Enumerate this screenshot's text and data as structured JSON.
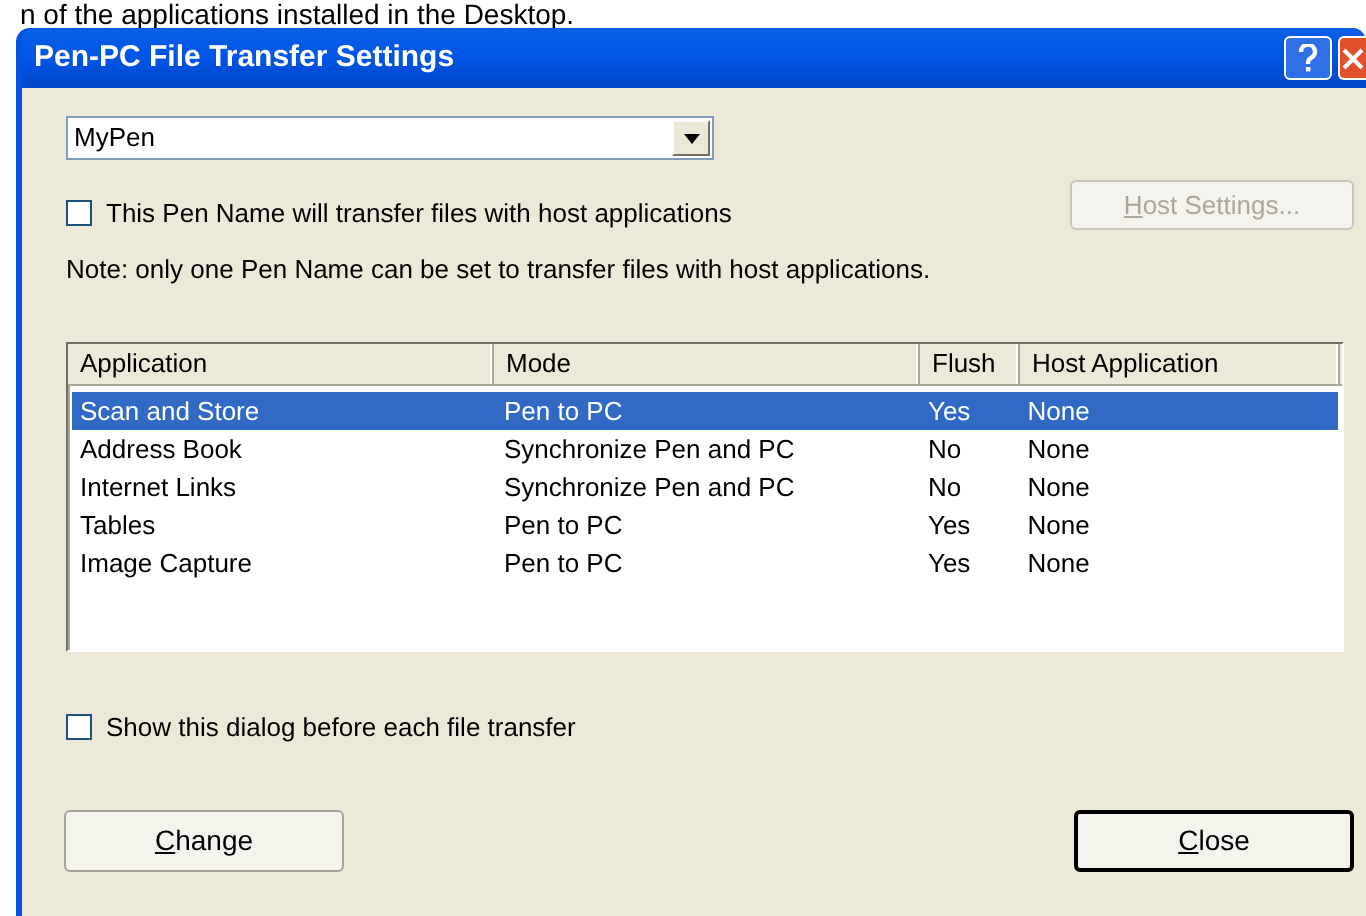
{
  "caption": "n of the applications installed in the Desktop.",
  "window": {
    "title": "Pen-PC File Transfer Settings"
  },
  "pen_name": {
    "value": "MyPen"
  },
  "transfer_checkbox": {
    "label": "This Pen Name will transfer files with host applications",
    "checked": false
  },
  "host_settings_button": {
    "label": "Host Settings...",
    "disabled": true
  },
  "note": "Note: only one Pen Name can be set to transfer files with host applications.",
  "table": {
    "columns": [
      "Application",
      "Mode",
      "Flush",
      "Host Application"
    ],
    "rows": [
      {
        "cells": [
          "Scan and Store",
          "Pen to PC",
          "Yes",
          "None"
        ],
        "selected": true
      },
      {
        "cells": [
          "Address Book",
          "Synchronize Pen and PC",
          "No",
          "None"
        ],
        "selected": false
      },
      {
        "cells": [
          "Internet Links",
          "Synchronize Pen and PC",
          "No",
          "None"
        ],
        "selected": false
      },
      {
        "cells": [
          "Tables",
          "Pen to PC",
          "Yes",
          "None"
        ],
        "selected": false
      },
      {
        "cells": [
          "Image Capture",
          "Pen to PC",
          "Yes",
          "None"
        ],
        "selected": false
      }
    ]
  },
  "show_dialog_checkbox": {
    "label": "Show this dialog before each file transfer",
    "checked": false
  },
  "buttons": [
    {
      "label": "Change",
      "default": false
    },
    {
      "label": "Close",
      "default": true
    }
  ]
}
